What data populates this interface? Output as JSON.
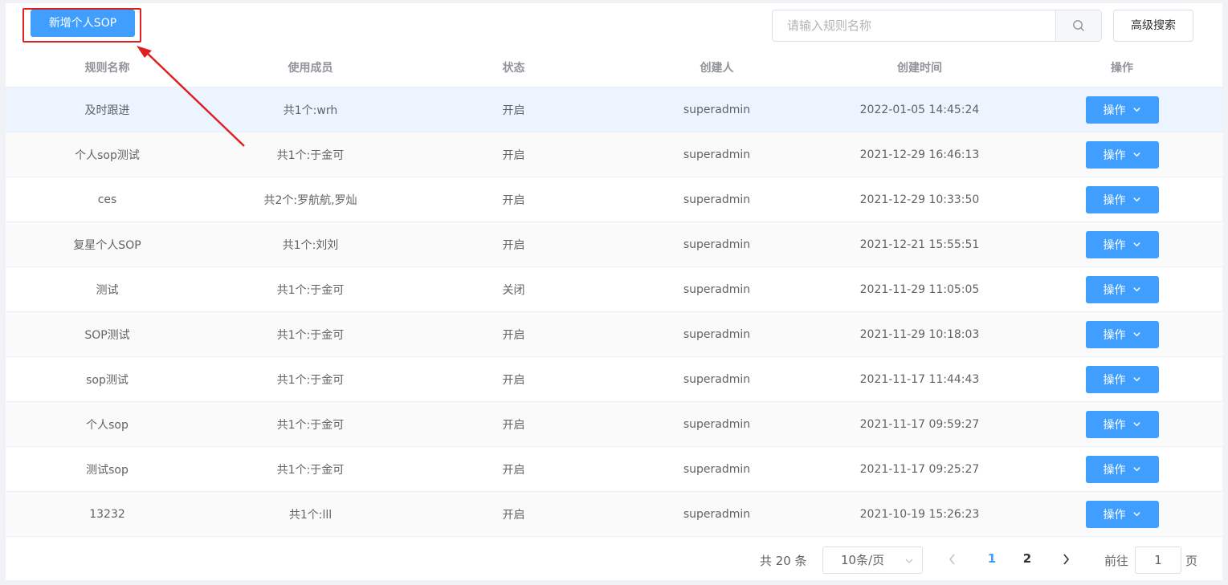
{
  "toolbar": {
    "add_button": "新增个人SOP",
    "search_placeholder": "请输入规则名称",
    "advanced_search": "高级搜索"
  },
  "table": {
    "headers": [
      "规则名称",
      "使用成员",
      "状态",
      "创建人",
      "创建时间",
      "操作"
    ],
    "action_label": "操作",
    "rows": [
      {
        "name": "及时跟进",
        "members": "共1个:wrh",
        "status": "开启",
        "creator": "superadmin",
        "time": "2022-01-05 14:45:24"
      },
      {
        "name": "个人sop测试",
        "members": "共1个:于金可",
        "status": "开启",
        "creator": "superadmin",
        "time": "2021-12-29 16:46:13"
      },
      {
        "name": "ces",
        "members": "共2个:罗航航,罗灿",
        "status": "开启",
        "creator": "superadmin",
        "time": "2021-12-29 10:33:50"
      },
      {
        "name": "复星个人SOP",
        "members": "共1个:刘刘",
        "status": "开启",
        "creator": "superadmin",
        "time": "2021-12-21 15:55:51"
      },
      {
        "name": "测试",
        "members": "共1个:于金可",
        "status": "关闭",
        "creator": "superadmin",
        "time": "2021-11-29 11:05:05"
      },
      {
        "name": "SOP测试",
        "members": "共1个:于金可",
        "status": "开启",
        "creator": "superadmin",
        "time": "2021-11-29 10:18:03"
      },
      {
        "name": "sop测试",
        "members": "共1个:于金可",
        "status": "开启",
        "creator": "superadmin",
        "time": "2021-11-17 11:44:43"
      },
      {
        "name": "个人sop",
        "members": "共1个:于金可",
        "status": "开启",
        "creator": "superadmin",
        "time": "2021-11-17 09:59:27"
      },
      {
        "name": "测试sop",
        "members": "共1个:于金可",
        "status": "开启",
        "creator": "superadmin",
        "time": "2021-11-17 09:25:27"
      },
      {
        "name": "13232",
        "members": "共1个:lll",
        "status": "开启",
        "creator": "superadmin",
        "time": "2021-10-19 15:26:23"
      }
    ]
  },
  "pagination": {
    "total": "共 20 条",
    "page_size": "10条/页",
    "pages": [
      "1",
      "2"
    ],
    "current_page": "1",
    "goto_label": "前往",
    "goto_value": "1",
    "goto_suffix": "页"
  },
  "colors": {
    "primary": "#409eff",
    "annotation": "#e02020",
    "row_hover": "#ecf5ff"
  }
}
